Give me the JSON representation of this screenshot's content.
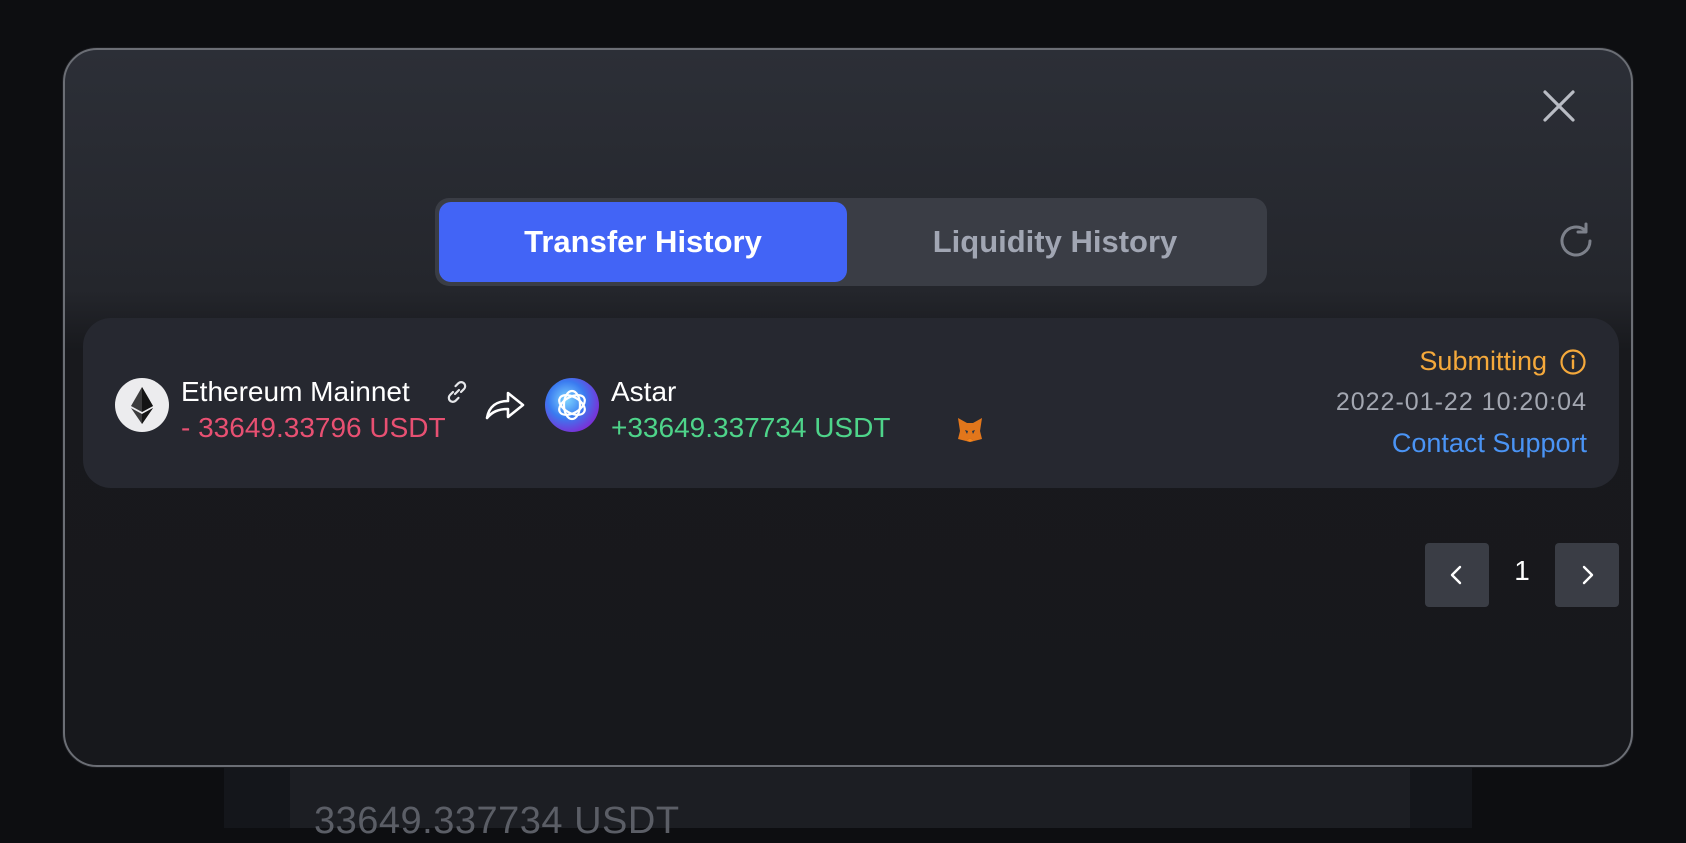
{
  "background": {
    "amount_text": "33649.337734 USDT"
  },
  "modal": {
    "tabs": [
      {
        "label": "Transfer History",
        "active": true
      },
      {
        "label": "Liquidity History",
        "active": false
      }
    ],
    "close_icon": "close-icon",
    "refresh_icon": "refresh-icon"
  },
  "transfer": {
    "from": {
      "chain": "Ethereum Mainnet",
      "amount": "- 33649.33796 USDT",
      "icon": "ethereum-icon"
    },
    "to": {
      "chain": "Astar",
      "amount": "+33649.337734 USDT",
      "icon": "astar-icon"
    },
    "status": "Submitting",
    "timestamp": "2022-01-22 10:20:04",
    "support_label": "Contact Support"
  },
  "pagination": {
    "current_page": "1"
  },
  "colors": {
    "accent": "#4264f6",
    "negative": "#e85072",
    "positive": "#4ed48a",
    "status_pending": "#f5a93b",
    "link": "#4a94f5"
  }
}
